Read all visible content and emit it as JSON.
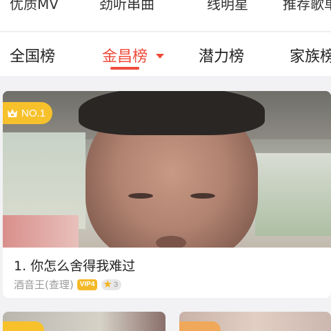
{
  "top_categories": [
    "优质MV",
    "劲听串曲",
    "线明星",
    "推荐歌单"
  ],
  "tabs": [
    {
      "label": "全国榜",
      "active": false
    },
    {
      "label": "金昌榜",
      "active": true
    },
    {
      "label": "潜力榜",
      "active": false
    },
    {
      "label": "家族榜",
      "active": false
    }
  ],
  "card": {
    "rank_badge": "NO.1",
    "title": "1. 你怎么舍得我难过",
    "singer": "酒音王(查理)",
    "vip_badge": "VIP4",
    "star_count": "3"
  },
  "colors": {
    "accent": "#ee4b3a",
    "rank_gold": "#f7c12b",
    "background": "#f2f2f4"
  }
}
